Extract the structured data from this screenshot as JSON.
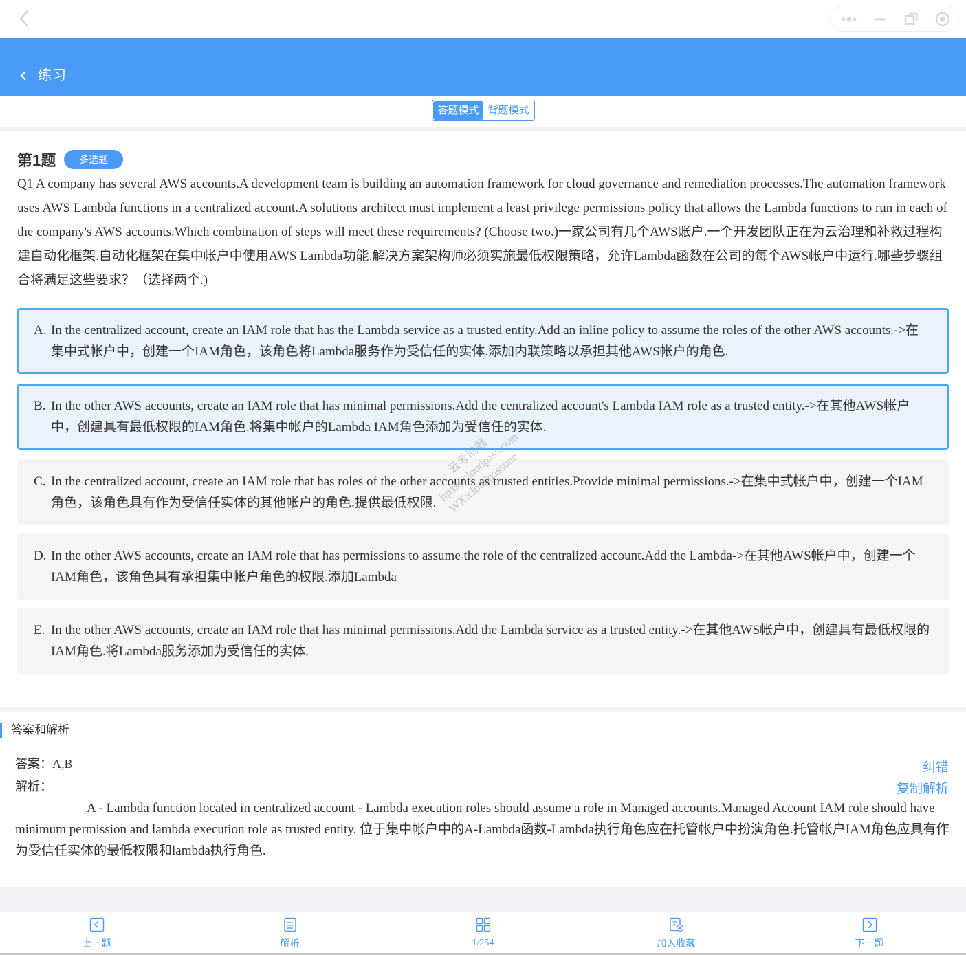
{
  "window": {
    "back_icon": "chevron-left-icon",
    "capsule_icons": [
      "more-dots-icon",
      "minimize-icon",
      "restore-icon",
      "close-circle-icon"
    ]
  },
  "header": {
    "title": "练习",
    "back_icon": "chevron-left-icon"
  },
  "mode": {
    "answer_mode": "答题模式",
    "review_mode": "背题模式",
    "active": "答题模式"
  },
  "question": {
    "number_label": "第1题",
    "type_badge": "多选题",
    "text": "Q1 A company has several AWS accounts.A development team is building an automation framework for cloud governance and remediation processes.The automation framework uses AWS Lambda functions in a centralized account.A solutions architect must implement a least privilege permissions policy that allows the Lambda functions to run in each of the company's AWS accounts.Which combination of steps will meet these requirements? (Choose two.)一家公司有几个AWS账户.一个开发团队正在为云治理和补救过程构建自动化框架.自动化框架在集中帐户中使用AWS Lambda功能.解决方案架构师必须实施最低权限策略，允许Lambda函数在公司的每个AWS帐户中运行.哪些步骤组合将满足这些要求？（选择两个.)",
    "options": [
      {
        "letter": "A.",
        "text": "In the centralized account, create an IAM role that has the Lambda service as a trusted entity.Add an inline policy to assume the roles of the other AWS accounts.->在集中式帐户中，创建一个IAM角色，该角色将Lambda服务作为受信任的实体.添加内联策略以承担其他AWS帐户的角色.",
        "selected": true
      },
      {
        "letter": "B.",
        "text": "In the other AWS accounts, create an IAM role that has minimal permissions.Add the centralized account's Lambda IAM role as a trusted entity.->在其他AWS帐户中，创建具有最低权限的IAM角色.将集中帐户的Lambda IAM角色添加为受信任的实体.",
        "selected": true
      },
      {
        "letter": "C.",
        "text": "In the centralized account, create an IAM role that has roles of the other accounts as trusted entities.Provide minimal permissions.->在集中式帐户中，创建一个IAM角色，该角色具有作为受信任实体的其他帐户的角色.提供最低权限.",
        "selected": false
      },
      {
        "letter": "D.",
        "text": "In the other AWS accounts, create an IAM role that has permissions to assume the role of the centralized account.Add the Lambda->在其他AWS帐户中，创建一个IAM角色，该角色具有承担集中帐户角色的权限.添加Lambda",
        "selected": false
      },
      {
        "letter": "E.",
        "text": "In the other AWS accounts, create an IAM role that has minimal permissions.Add the Lambda service as a trusted entity.->在其他AWS帐户中，创建具有最低权限的IAM角色.将Lambda服务添加为受信任的实体.",
        "selected": false
      }
    ]
  },
  "watermark": {
    "line1": "云考助器",
    "line2": "itpass.cloudpass.com",
    "line3": "WX:cloudpassone"
  },
  "answer": {
    "section_title": "答案和解析",
    "answer_label": "答案：",
    "answer_value": "A,B",
    "explanation_label": "解析：",
    "report_error": "纠错",
    "copy_explanation": "复制解析",
    "explanation_text": "A - Lambda function located in centralized account - Lambda execution roles should assume a role in Managed accounts.Managed Account IAM role should have minimum permission and lambda execution role as trusted entity. 位于集中帐户中的A-Lambda函数-Lambda执行角色应在托管帐户中扮演角色.托管帐户IAM角色应具有作为受信任实体的最低权限和lambda执行角色."
  },
  "bottom_nav": {
    "prev": {
      "label": "上一题",
      "icon": "prev-arrow-icon"
    },
    "explain": {
      "label": "解析",
      "icon": "document-icon"
    },
    "progress": {
      "label": "1/254",
      "icon": "grid-icon"
    },
    "favorite": {
      "label": "加入收藏",
      "icon": "bookmark-icon"
    },
    "next": {
      "label": "下一题",
      "icon": "next-arrow-icon"
    }
  },
  "colors": {
    "accent": "#4a9bf5",
    "selected_border": "#4aa8ec",
    "selected_bg": "#eaf3fc",
    "option_bg": "#f5f5f5"
  }
}
